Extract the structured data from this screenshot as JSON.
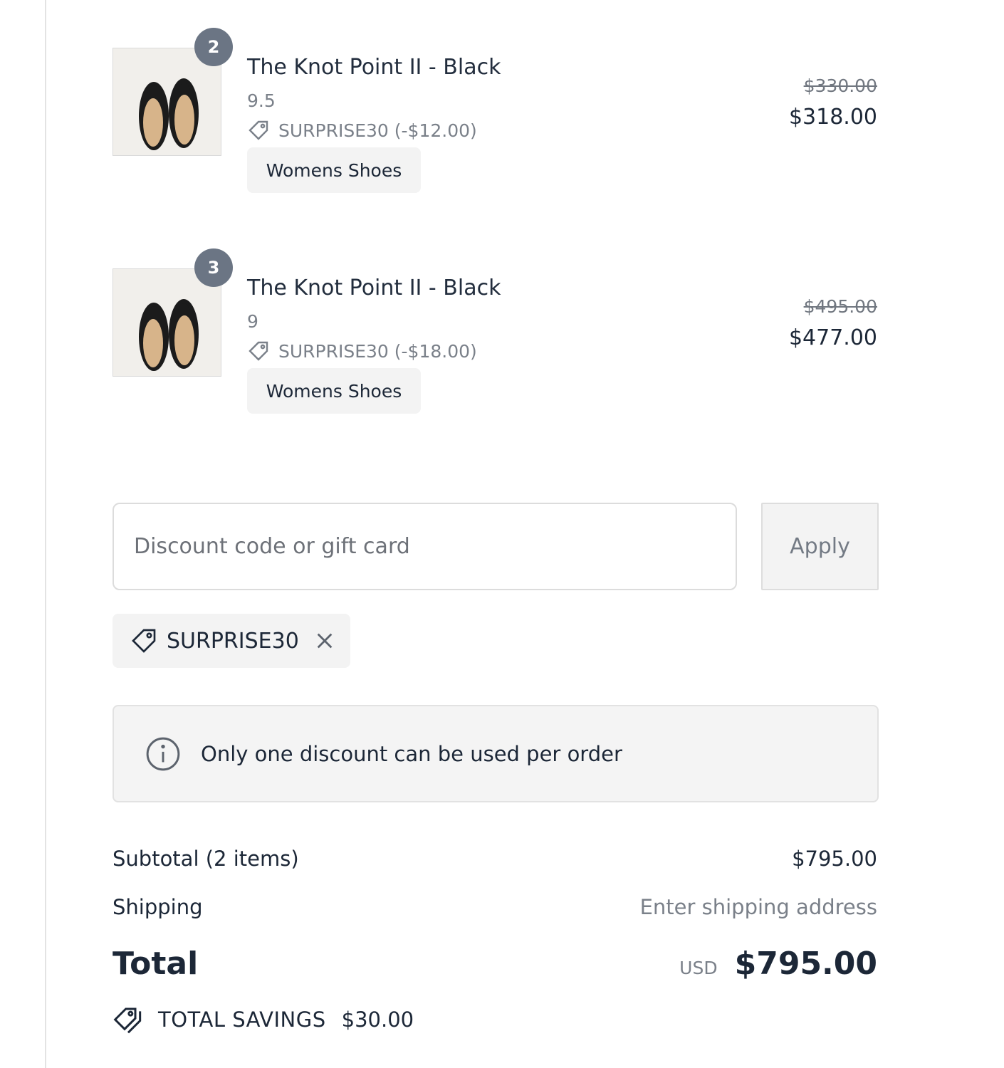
{
  "items": [
    {
      "quantity": "2",
      "title": "The Knot Point II - Black",
      "variant": "9.5",
      "discount_text": "SURPRISE30 (-$12.00)",
      "category": "Womens Shoes",
      "original_price": "$330.00",
      "price": "$318.00"
    },
    {
      "quantity": "3",
      "title": "The Knot Point II - Black",
      "variant": "9",
      "discount_text": "SURPRISE30 (-$18.00)",
      "category": "Womens Shoes",
      "original_price": "$495.00",
      "price": "$477.00"
    }
  ],
  "discount_form": {
    "placeholder": "Discount code or gift card",
    "value": "",
    "apply_label": "Apply"
  },
  "applied_code": {
    "code": "SURPRISE30",
    "icon": "tag-icon",
    "remove_icon": "close-icon"
  },
  "notice": {
    "icon": "info-icon",
    "text": "Only one discount can be used per order"
  },
  "summary": {
    "subtotal_label": "Subtotal (2 items)",
    "subtotal_value": "$795.00",
    "shipping_label": "Shipping",
    "shipping_value": "Enter shipping address",
    "total_label": "Total",
    "currency": "USD",
    "total_value": "$795.00",
    "savings_label": "TOTAL SAVINGS",
    "savings_value": "$30.00"
  },
  "colors": {
    "text": "#1c2737",
    "muted": "#7a8089",
    "badge": "#6b7584",
    "panel": "#f3f3f3",
    "border": "#dcdcdc"
  }
}
